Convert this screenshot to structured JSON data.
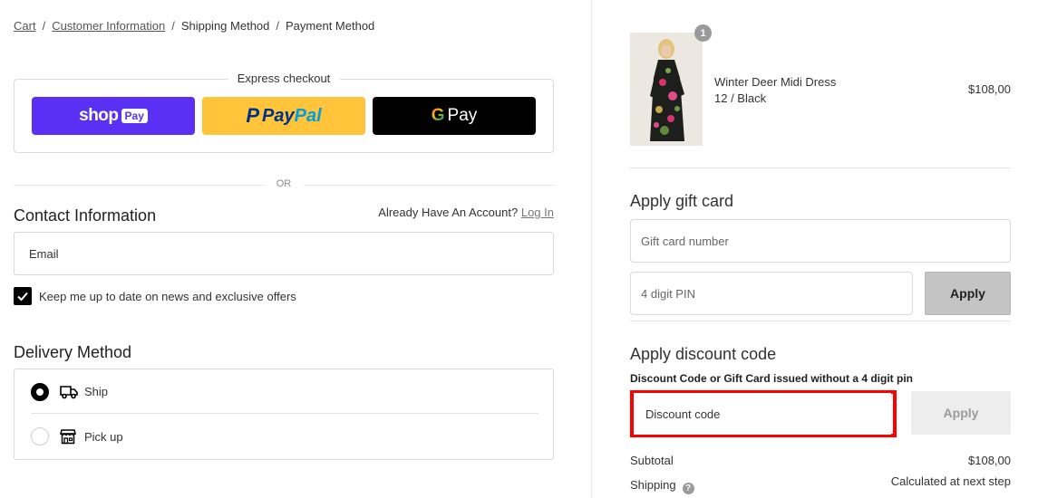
{
  "breadcrumb": {
    "items": [
      {
        "label": "Cart"
      },
      {
        "label": "Customer Information"
      },
      {
        "label": "Shipping Method"
      },
      {
        "label": "Payment Method"
      }
    ],
    "separator": "/"
  },
  "express_checkout": {
    "title": "Express checkout",
    "shop_pay": {
      "word": "shop",
      "badge": "Pay"
    },
    "paypal": {
      "icon": "P",
      "word_part1": "Pay",
      "word_part2": "Pal"
    },
    "google_pay": {
      "icon": "G",
      "word": "Pay"
    }
  },
  "divider_or": "OR",
  "contact": {
    "title": "Contact Information",
    "account_prompt": "Already Have An Account?",
    "login_label": "Log In",
    "email_placeholder": "Email",
    "newsletter_label": "Keep me up to date on news and exclusive offers",
    "newsletter_checked": true
  },
  "delivery": {
    "title": "Delivery Method",
    "options": [
      {
        "label": "Ship",
        "icon": "truck-icon",
        "selected": true
      },
      {
        "label": "Pick up",
        "icon": "store-icon",
        "selected": false
      }
    ]
  },
  "order": {
    "product": {
      "name": "Winter Deer Midi Dress",
      "variant": "12 / Black",
      "price": "$108,00",
      "quantity": "1"
    }
  },
  "gift_card": {
    "title": "Apply gift card",
    "number_placeholder": "Gift card number",
    "pin_placeholder": "4 digit PIN",
    "apply_label": "Apply"
  },
  "discount": {
    "title": "Apply discount code",
    "note": "Discount Code or Gift Card issued without a 4 digit pin",
    "placeholder": "Discount code",
    "apply_label": "Apply",
    "highlight_color": "#ff0000"
  },
  "summary": {
    "subtotal_label": "Subtotal",
    "subtotal_value": "$108,00",
    "shipping_label": "Shipping",
    "shipping_help": "?",
    "shipping_value": "Calculated at next step"
  },
  "colors": {
    "shop_pay": "#5a31f4",
    "paypal": "#ffc439",
    "google_pay": "#000000",
    "checkbox": "#000000"
  }
}
